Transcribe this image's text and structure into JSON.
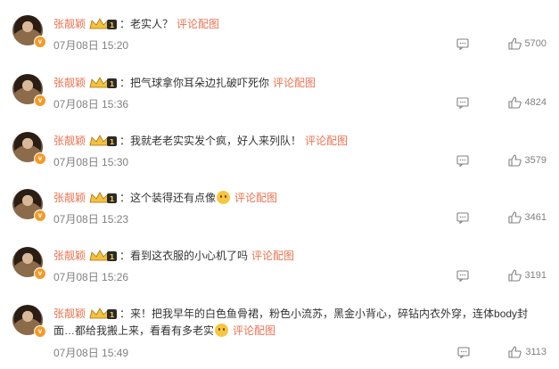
{
  "colors": {
    "username": "#eb7350",
    "text": "#333333",
    "meta": "#808080",
    "vip_badge": "#f39b27"
  },
  "comments": [
    {
      "username": "张靓颖",
      "text": "老实人？",
      "link": "评论配图",
      "time": "07月08日 15:20",
      "likes": "5700"
    },
    {
      "username": "张靓颖",
      "text": "把气球拿你耳朵边扎破吓死你",
      "link": "评论配图",
      "time": "07月08日 15:36",
      "likes": "4824"
    },
    {
      "username": "张靓颖",
      "text": "我就老老实实发个疯，好人来列队！",
      "link": "评论配图",
      "time": "07月08日 15:30",
      "likes": "3579"
    },
    {
      "username": "张靓颖",
      "text": "这个装得还有点像",
      "emoji": "thinking-emoji",
      "link": "评论配图",
      "time": "07月08日 15:23",
      "likes": "3461"
    },
    {
      "username": "张靓颖",
      "text": "看到这衣服的小心机了吗",
      "link": "评论配图",
      "time": "07月08日 15:26",
      "likes": "3191"
    },
    {
      "username": "张靓颖",
      "text_line1": "来！把我早年的白色鱼骨裙，粉色小流苏，黑金小背心，碎钻内衣外穿，连体body封",
      "text_line2": "面…都给我搬上来，看看有多老实",
      "emoji": "smile-emoji",
      "link": "评论配图",
      "time": "07月08日 15:49",
      "likes": "3113"
    }
  ],
  "colon": "："
}
